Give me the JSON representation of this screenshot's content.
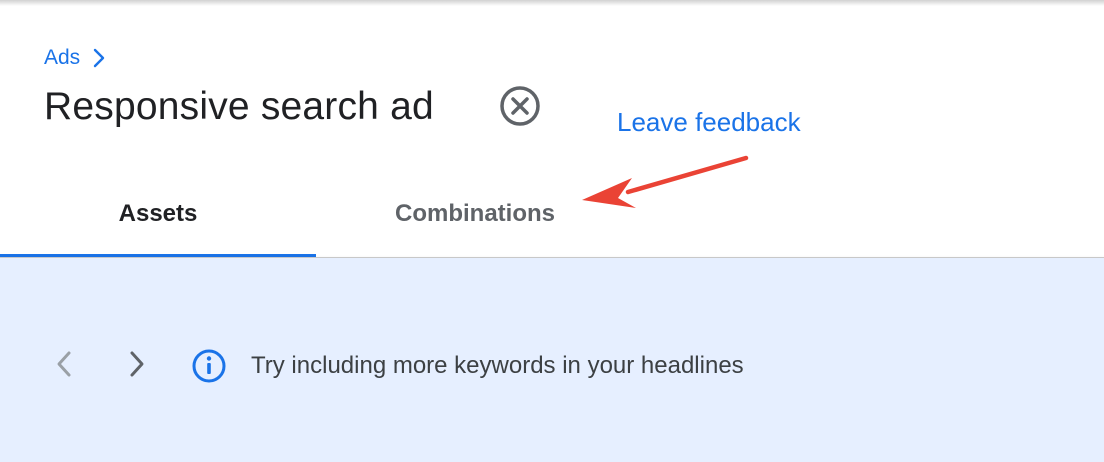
{
  "breadcrumb": {
    "label": "Ads",
    "chevron_icon": "chevron-right-icon"
  },
  "header": {
    "title": "Responsive search ad",
    "close_icon": "close-circle-icon",
    "feedback_label": "Leave feedback"
  },
  "tabs": [
    {
      "label": "Assets",
      "selected": true
    },
    {
      "label": "Combinations",
      "selected": false
    }
  ],
  "annotation": {
    "type": "arrow",
    "color": "#ea4335",
    "points_to": "Combinations"
  },
  "tip": {
    "prev_icon": "chevron-left-icon",
    "next_icon": "chevron-right-icon",
    "info_icon": "info-icon",
    "text": "Try including more keywords in your headlines"
  },
  "colors": {
    "accent": "#1a73e8",
    "content_bg": "#e6efff",
    "title": "#202124",
    "tab_inactive": "#5f6368",
    "arrow": "#ea4335"
  }
}
